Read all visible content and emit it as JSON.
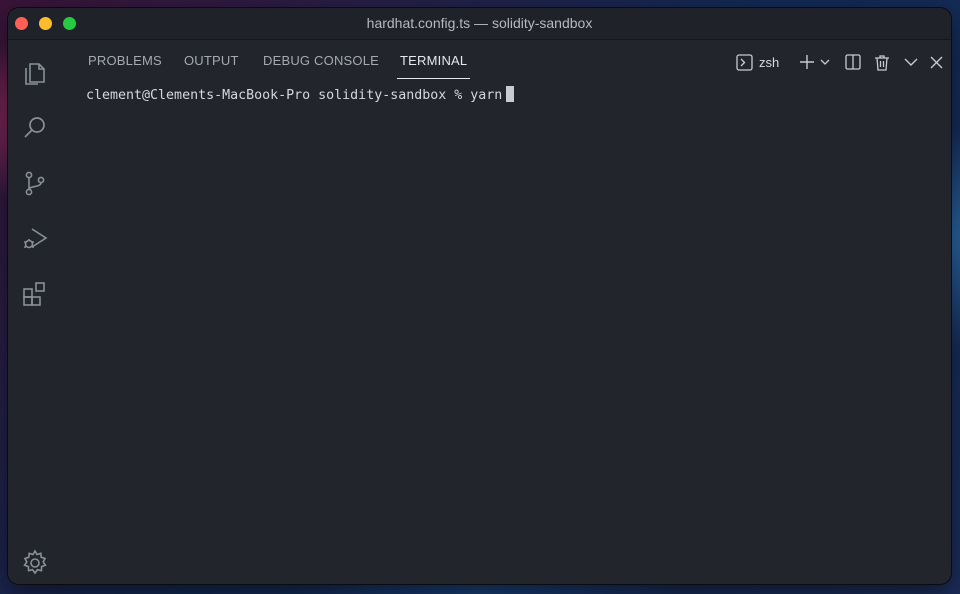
{
  "window": {
    "title": "hardhat.config.ts — solidity-sandbox"
  },
  "activity_bar": {
    "icons": [
      "files-icon",
      "search-icon",
      "source-control-icon",
      "run-debug-icon",
      "extensions-icon",
      "gear-icon"
    ]
  },
  "panel": {
    "tabs": [
      {
        "label": "PROBLEMS",
        "active": false
      },
      {
        "label": "OUTPUT",
        "active": false
      },
      {
        "label": "DEBUG CONSOLE",
        "active": false
      },
      {
        "label": "TERMINAL",
        "active": true
      }
    ],
    "shell": "zsh"
  },
  "terminal": {
    "prompt": "clement@Clements-MacBook-Pro solidity-sandbox % ",
    "input": "yarn"
  },
  "colors": {
    "background": "#22252c",
    "text": "#d4d7dd",
    "tab_active": "#e6e8ec",
    "close": "#fe5f57",
    "minimize": "#febc2e",
    "maximize": "#28c840"
  }
}
